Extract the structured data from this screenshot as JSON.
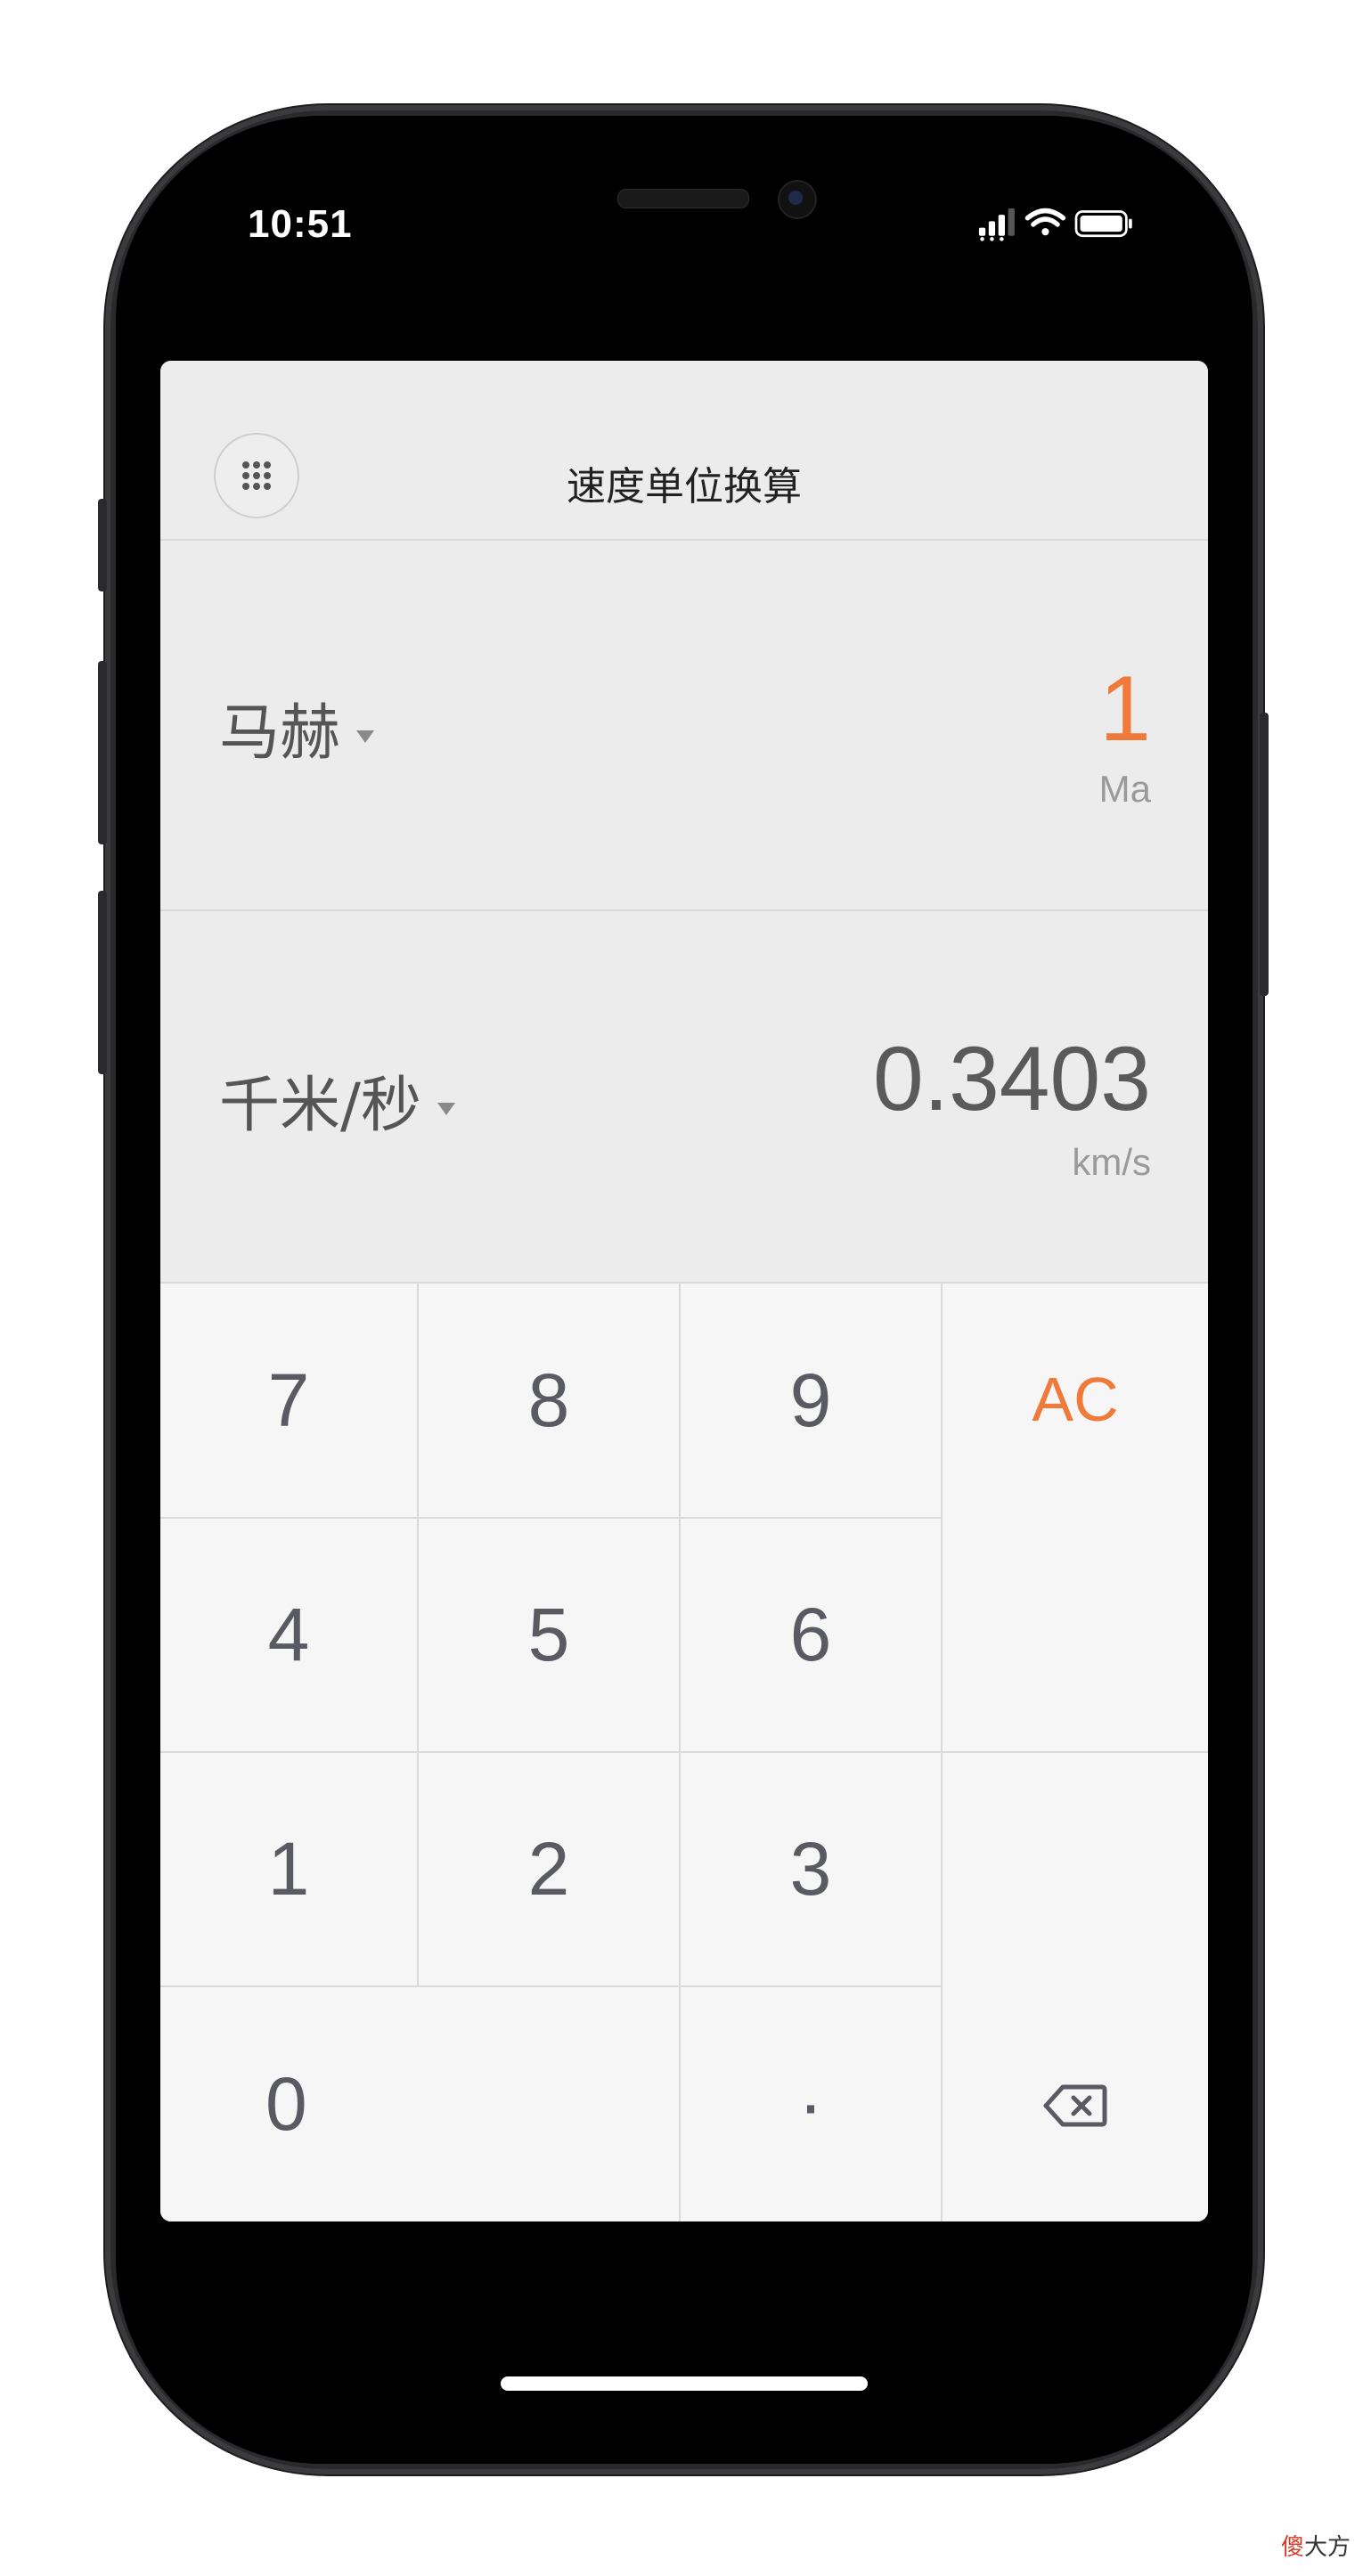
{
  "status_bar": {
    "time": "10:51"
  },
  "app": {
    "title": "速度单位换算",
    "menu_icon": "grid-dots-icon",
    "accent_color": "#f07a3a"
  },
  "from": {
    "unit_name": "马赫",
    "value": "1",
    "unit_abbr": "Ma"
  },
  "to": {
    "unit_name": "千米/秒",
    "value": "0.3403",
    "unit_abbr": "km/s"
  },
  "keypad": {
    "k7": "7",
    "k8": "8",
    "k9": "9",
    "ac": "AC",
    "k4": "4",
    "k5": "5",
    "k6": "6",
    "k1": "1",
    "k2": "2",
    "k3": "3",
    "k0": "0",
    "dot": "·",
    "backspace_icon": "backspace-icon"
  },
  "watermark": {
    "first": "傻",
    "rest": "大方"
  }
}
